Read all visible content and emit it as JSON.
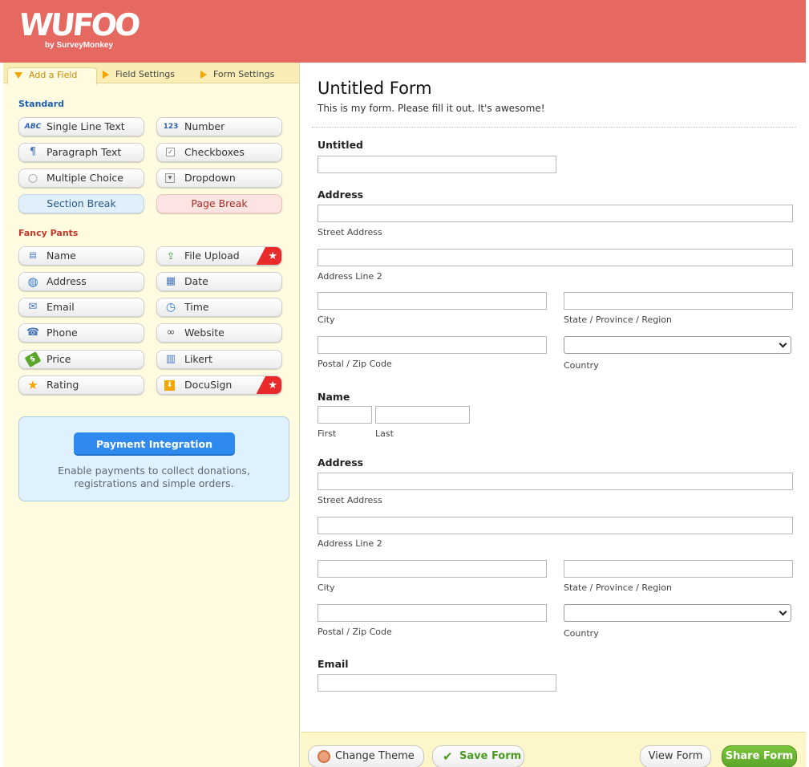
{
  "brand": {
    "logo": "WUFOO",
    "sub": "by SurveyMonkey"
  },
  "tabs": [
    {
      "label": "Add a Field",
      "active": true
    },
    {
      "label": "Field Settings",
      "active": false
    },
    {
      "label": "Form Settings",
      "active": false
    }
  ],
  "standard": {
    "title": "Standard",
    "fields": [
      {
        "label": "Single Line Text",
        "icon": "abc-icon",
        "glyph": "ABC"
      },
      {
        "label": "Number",
        "icon": "number-icon",
        "glyph": "123"
      },
      {
        "label": "Paragraph Text",
        "icon": "paragraph-icon",
        "glyph": "¶"
      },
      {
        "label": "Checkboxes",
        "icon": "checkbox-icon",
        "glyph": "✓"
      },
      {
        "label": "Multiple Choice",
        "icon": "radio-icon",
        "glyph": "○"
      },
      {
        "label": "Dropdown",
        "icon": "dropdown-icon",
        "glyph": "▾"
      },
      {
        "label": "Section Break"
      },
      {
        "label": "Page Break"
      }
    ]
  },
  "fancy": {
    "title": "Fancy Pants",
    "fields": [
      {
        "label": "Name",
        "icon": "name-card-icon",
        "glyph": "▤"
      },
      {
        "label": "File Upload",
        "icon": "file-upload-icon",
        "glyph": "⇪",
        "premium": true
      },
      {
        "label": "Address",
        "icon": "globe-icon",
        "glyph": "◍"
      },
      {
        "label": "Date",
        "icon": "calendar-icon",
        "glyph": "▦"
      },
      {
        "label": "Email",
        "icon": "envelope-icon",
        "glyph": "✉"
      },
      {
        "label": "Time",
        "icon": "clock-icon",
        "glyph": "◷"
      },
      {
        "label": "Phone",
        "icon": "phone-icon",
        "glyph": "☎"
      },
      {
        "label": "Website",
        "icon": "link-icon",
        "glyph": "∞"
      },
      {
        "label": "Price",
        "icon": "money-icon",
        "glyph": "$"
      },
      {
        "label": "Likert",
        "icon": "likert-icon",
        "glyph": "▥"
      },
      {
        "label": "Rating",
        "icon": "star-icon",
        "glyph": "★"
      },
      {
        "label": "DocuSign",
        "icon": "docusign-icon",
        "glyph": "⬇",
        "premium": true
      }
    ],
    "premium_glyph": "★"
  },
  "payment": {
    "button": "Payment Integration",
    "text": "Enable payments to collect donations, registrations and simple orders."
  },
  "form": {
    "title": "Untitled Form",
    "description": "This is my form. Please fill it out. It's awesome!",
    "untitled_label": "Untitled",
    "address1": {
      "label": "Address",
      "street": "Street Address",
      "line2": "Address Line 2",
      "city": "City",
      "state": "State / Province / Region",
      "postal": "Postal / Zip Code",
      "country": "Country"
    },
    "name": {
      "label": "Name",
      "first": "First",
      "last": "Last"
    },
    "address2": {
      "label": "Address",
      "street": "Street Address",
      "line2": "Address Line 2",
      "city": "City",
      "state": "State / Province / Region",
      "postal": "Postal / Zip Code",
      "country": "Country"
    },
    "email_label": "Email"
  },
  "footer": {
    "change_theme": "Change Theme",
    "save_form": "Save Form",
    "view_form": "View Form",
    "share_form": "Share Form"
  },
  "colors": {
    "header": "#e66961",
    "sidebar_bg": "#fffbe0",
    "accent_blue": "#2f8af0",
    "share_green": "#5aa52a",
    "premium_red": "#e92a2a"
  }
}
